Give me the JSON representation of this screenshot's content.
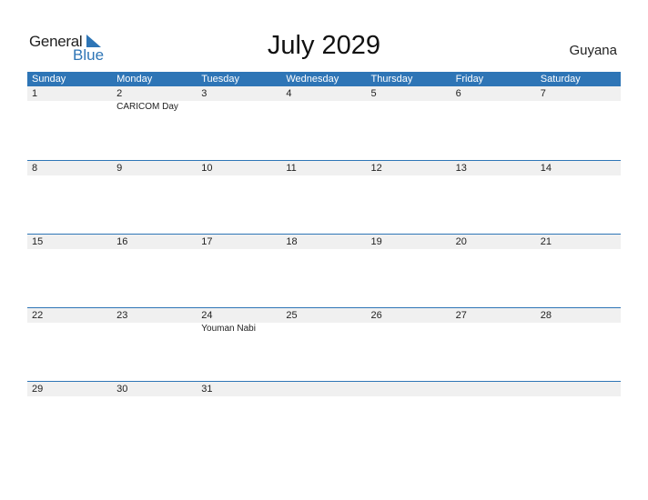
{
  "logo": {
    "text_general": "General",
    "text_blue": "Blue",
    "icon": "triangle-flag-icon"
  },
  "title": "July 2029",
  "country": "Guyana",
  "colors": {
    "accent": "#2e75b6",
    "strip": "#f0f0f0"
  },
  "days_of_week": [
    "Sunday",
    "Monday",
    "Tuesday",
    "Wednesday",
    "Thursday",
    "Friday",
    "Saturday"
  ],
  "weeks": [
    {
      "days": [
        "1",
        "2",
        "3",
        "4",
        "5",
        "6",
        "7"
      ],
      "events": [
        "",
        "CARICOM Day",
        "",
        "",
        "",
        "",
        ""
      ]
    },
    {
      "days": [
        "8",
        "9",
        "10",
        "11",
        "12",
        "13",
        "14"
      ],
      "events": [
        "",
        "",
        "",
        "",
        "",
        "",
        ""
      ]
    },
    {
      "days": [
        "15",
        "16",
        "17",
        "18",
        "19",
        "20",
        "21"
      ],
      "events": [
        "",
        "",
        "",
        "",
        "",
        "",
        ""
      ]
    },
    {
      "days": [
        "22",
        "23",
        "24",
        "25",
        "26",
        "27",
        "28"
      ],
      "events": [
        "",
        "",
        "Youman Nabi",
        "",
        "",
        "",
        ""
      ]
    },
    {
      "days": [
        "29",
        "30",
        "31",
        "",
        "",
        "",
        ""
      ],
      "events": [
        "",
        "",
        "",
        "",
        "",
        "",
        ""
      ]
    }
  ]
}
